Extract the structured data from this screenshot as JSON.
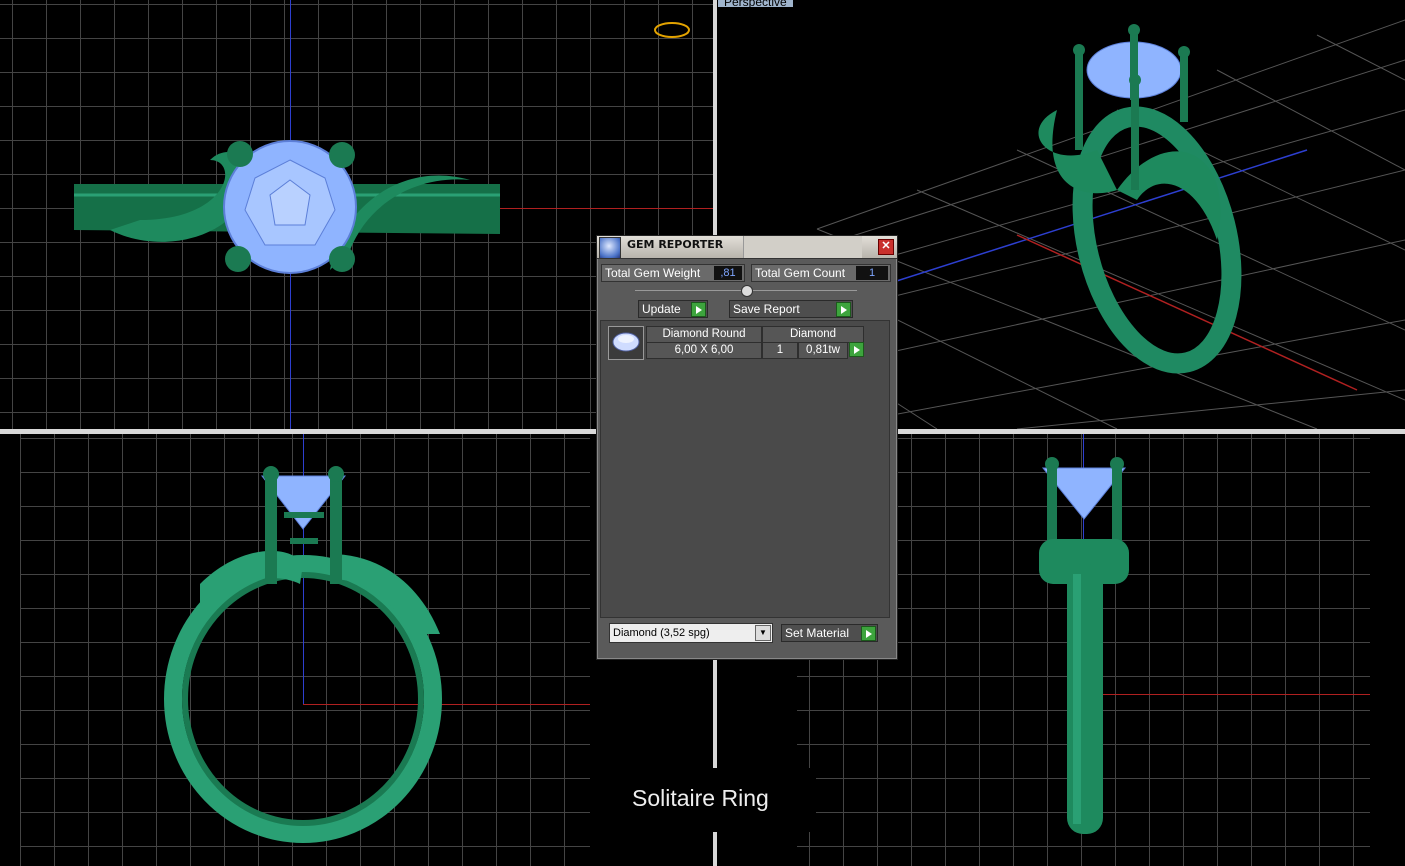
{
  "viewports": {
    "perspective_label": "Perspective"
  },
  "gem_reporter": {
    "title": "GEM REPORTER",
    "close_icon": "close-icon",
    "total_weight_label": "Total Gem Weight",
    "total_weight_value": ",81",
    "total_count_label": "Total Gem Count",
    "total_count_value": "1",
    "update_label": "Update",
    "save_report_label": "Save Report",
    "gems": [
      {
        "shape": "Diamond Round",
        "material": "Diamond",
        "size": "6,00 X 6,00",
        "count": "1",
        "weight": "0,81tw"
      }
    ],
    "material_select": "Diamond     (3,52 spg)",
    "set_material_label": "Set Material"
  },
  "caption": "Solitaire Ring",
  "colors": {
    "metal": "#1f8a62",
    "gem": "#8fb4ff",
    "grid": "#444444",
    "accent_button": "#3da43d"
  }
}
